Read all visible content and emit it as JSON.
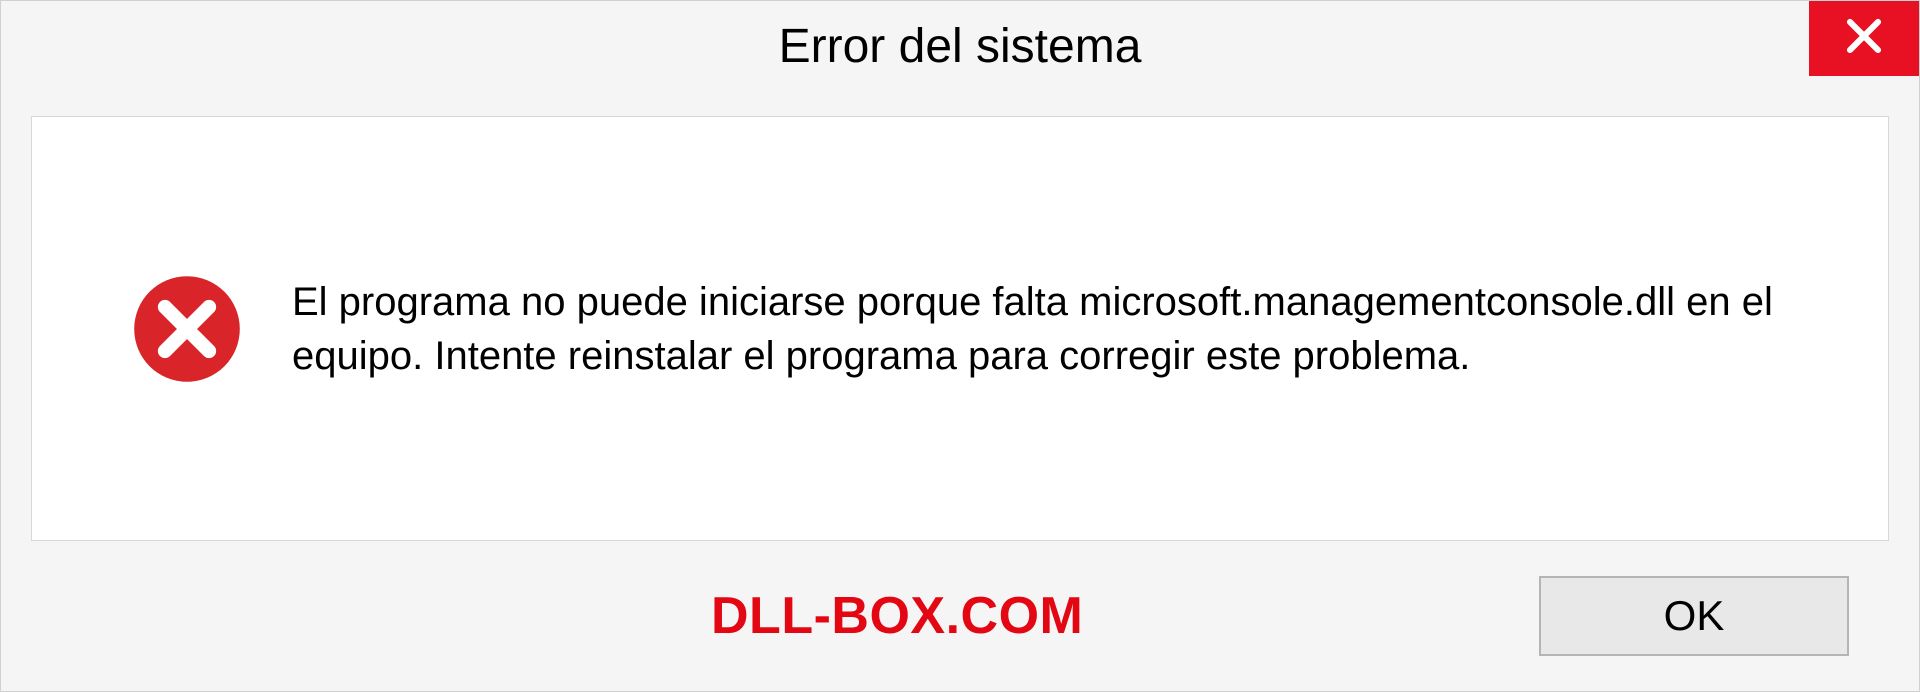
{
  "dialog": {
    "title": "Error del sistema",
    "message": "El programa no puede iniciarse porque falta microsoft.managementconsole.dll en el equipo. Intente reinstalar el programa para corregir este problema.",
    "ok_label": "OK"
  },
  "watermark": "DLL-BOX.COM",
  "colors": {
    "close_red": "#e81123",
    "error_red": "#d9252a",
    "watermark_red": "#e30613"
  }
}
